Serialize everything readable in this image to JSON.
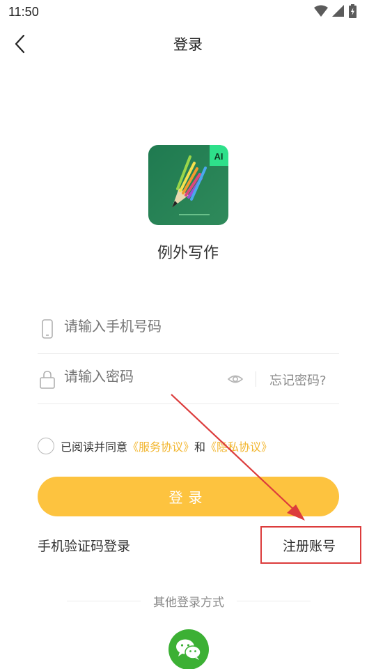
{
  "status_bar": {
    "time": "11:50"
  },
  "header": {
    "title": "登录"
  },
  "app": {
    "name": "例外写作",
    "logo_badge": "AI"
  },
  "form": {
    "phone_placeholder": "请输入手机号码",
    "password_placeholder": "请输入密码",
    "forgot_label": "忘记密码?"
  },
  "agreement": {
    "prefix": "已阅读并同意",
    "service_link": "《服务协议》",
    "and": "和",
    "privacy_link": "《隐私协议》"
  },
  "login_button": "登录",
  "sms_login": "手机验证码登录",
  "register": "注册账号",
  "other_login": "其他登录方式",
  "colors": {
    "accent": "#fdc33f",
    "link": "#f2b630",
    "annotation": "#dc3c3c",
    "wechat": "#3cb034"
  },
  "icons": [
    "back-arrow-icon",
    "wifi-icon",
    "signal-icon",
    "battery-icon",
    "phone-icon",
    "lock-icon",
    "eye-icon",
    "wechat-icon"
  ]
}
